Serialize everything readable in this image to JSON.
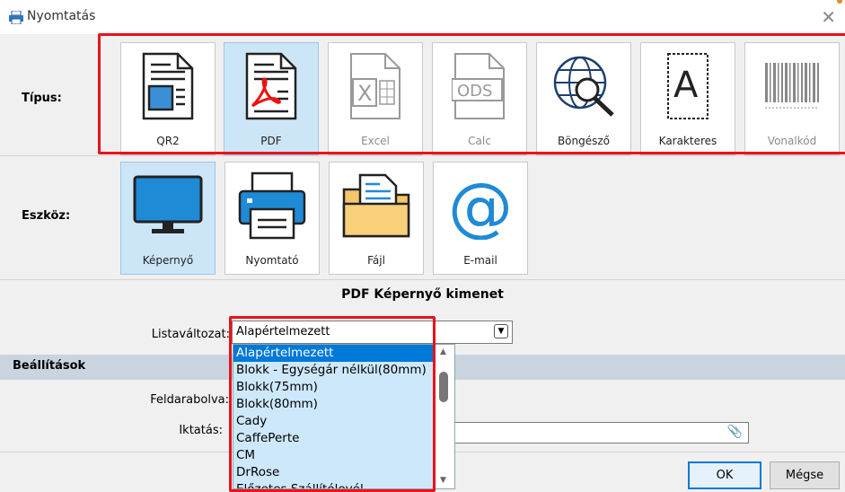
{
  "window": {
    "title": "Nyomtatás"
  },
  "tipus": {
    "label": "Típus:",
    "tiles": [
      {
        "label": "QR2",
        "icon": "qr2-document-icon",
        "state": "normal"
      },
      {
        "label": "PDF",
        "icon": "pdf-document-icon",
        "state": "selected"
      },
      {
        "label": "Excel",
        "icon": "excel-document-icon",
        "state": "disabled"
      },
      {
        "label": "Calc",
        "icon": "ods-document-icon",
        "state": "disabled"
      },
      {
        "label": "Böngésző",
        "icon": "globe-search-icon",
        "state": "normal"
      },
      {
        "label": "Karakteres",
        "icon": "text-document-icon",
        "state": "normal"
      },
      {
        "label": "Vonalkód",
        "icon": "barcode-icon",
        "state": "disabled"
      }
    ]
  },
  "eszkoz": {
    "label": "Eszköz:",
    "tiles": [
      {
        "label": "Képernyő",
        "icon": "monitor-icon",
        "state": "selected"
      },
      {
        "label": "Nyomtató",
        "icon": "printer-icon",
        "state": "normal"
      },
      {
        "label": "Fájl",
        "icon": "folder-file-icon",
        "state": "normal"
      },
      {
        "label": "E-mail",
        "icon": "at-sign-icon",
        "state": "normal"
      }
    ]
  },
  "output": {
    "title": "PDF Képernyő kimenet",
    "listavaltozat_label": "Listaváltozat:",
    "listavaltozat_value": "Alapértelmezett",
    "options": [
      "Alapértelmezett",
      "Blokk - Egységár nélkül(80mm)",
      "Blokk(75mm)",
      "Blokk(80mm)",
      "Cady",
      "CaffePerte",
      "CM",
      "DrRose",
      "Előzetes Szállítólevél"
    ],
    "selected_option": "Alapértelmezett"
  },
  "settings": {
    "title": "Beállítások",
    "feldarabolva_label": "Feldarabolva:",
    "iktatas_label": "Iktatás:",
    "iktatas_value": ""
  },
  "buttons": {
    "ok": "OK",
    "cancel": "Mégse"
  },
  "colors": {
    "highlight": "#e8131b",
    "selected_tile": "#cde6f7",
    "accent": "#0078d7"
  }
}
